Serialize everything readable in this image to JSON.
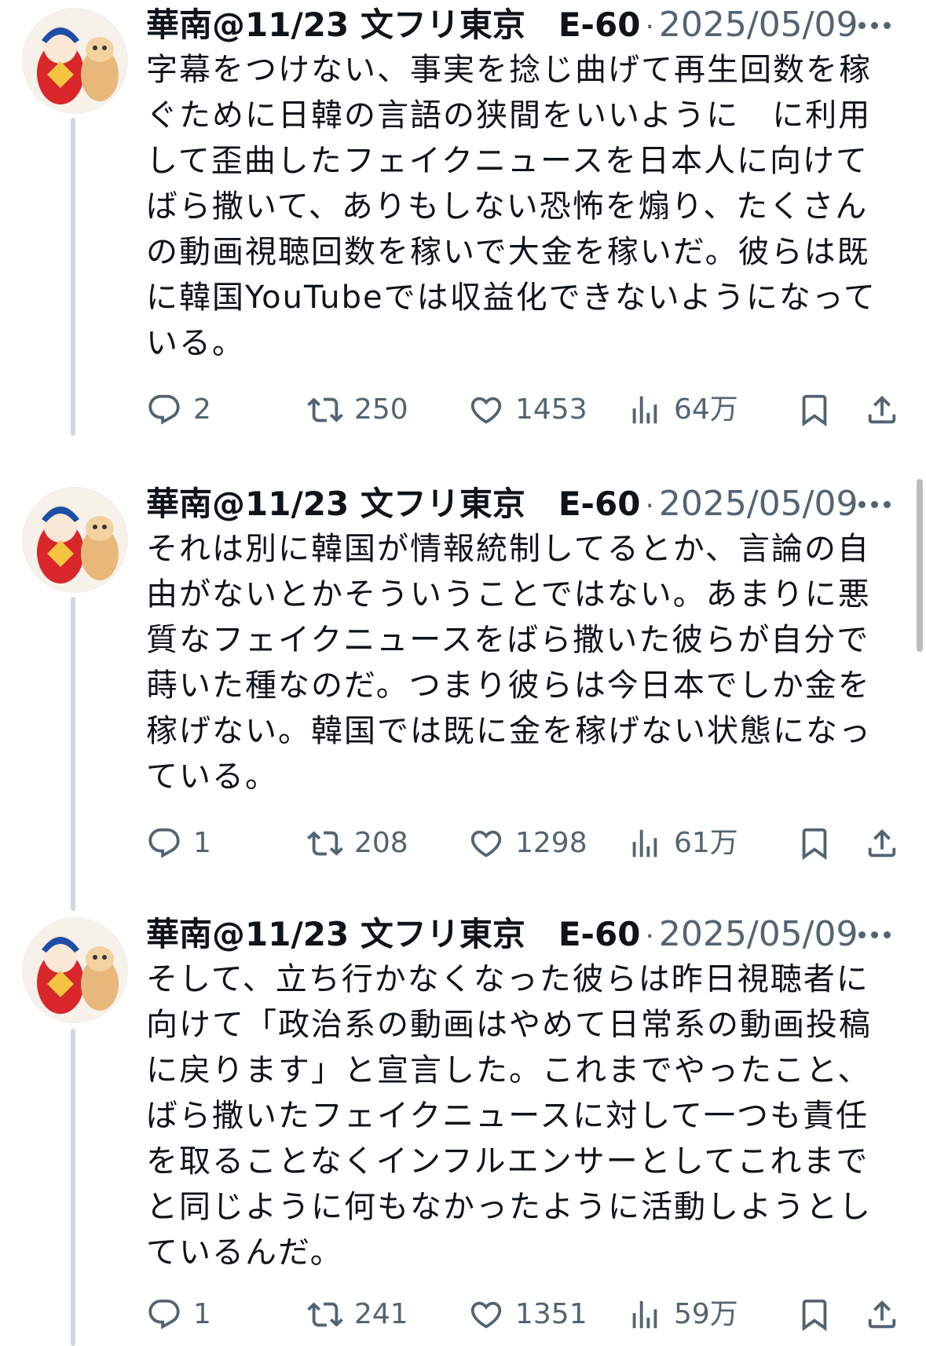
{
  "tweets": [
    {
      "name": "華南@11/23 文フリ東京　E-60",
      "separator": "·",
      "date": "2025/05/09",
      "text": "字幕をつけない、事実を捻じ曲げて再生回数を稼ぐために日韓の言語の狭間をいいように　に利用して歪曲したフェイクニュースを日本人に向けてばら撒いて、ありもしない恐怖を煽り、たくさんの動画視聴回数を稼いで大金を稼いだ。彼らは既に韓国YouTubeでは収益化できないようになっている。",
      "replies": "2",
      "retweets": "250",
      "likes": "1453",
      "views": "64万"
    },
    {
      "name": "華南@11/23 文フリ東京　E-60",
      "separator": "·",
      "date": "2025/05/09",
      "text": "それは別に韓国が情報統制してるとか、言論の自由がないとかそういうことではない。あまりに悪質なフェイクニュースをばら撒いた彼らが自分で蒔いた種なのだ。つまり彼らは今日本でしか金を稼げない。韓国では既に金を稼げない状態になっている。",
      "replies": "1",
      "retweets": "208",
      "likes": "1298",
      "views": "61万"
    },
    {
      "name": "華南@11/23 文フリ東京　E-60",
      "separator": "·",
      "date": "2025/05/09",
      "text": "そして、立ち行かなくなった彼らは昨日視聴者に向けて「政治系の動画はやめて日常系の動画投稿に戻ります」と宣言した。これまでやったこと、ばら撒いたフェイクニュースに対して一つも責任を取ることなくインフルエンサーとしてこれまでと同じように何もなかったように活動しようとしているんだ。",
      "replies": "1",
      "retweets": "241",
      "likes": "1351",
      "views": "59万"
    }
  ],
  "icons": {
    "reply": "reply-icon",
    "retweet": "retweet-icon",
    "like": "heart-icon",
    "views": "views-chart-icon",
    "bookmark": "bookmark-icon",
    "share": "share-icon",
    "more": "more-dots-icon"
  },
  "colors": {
    "text": "#0f1419",
    "secondary": "#536471",
    "thread_line": "#cfd9de"
  }
}
